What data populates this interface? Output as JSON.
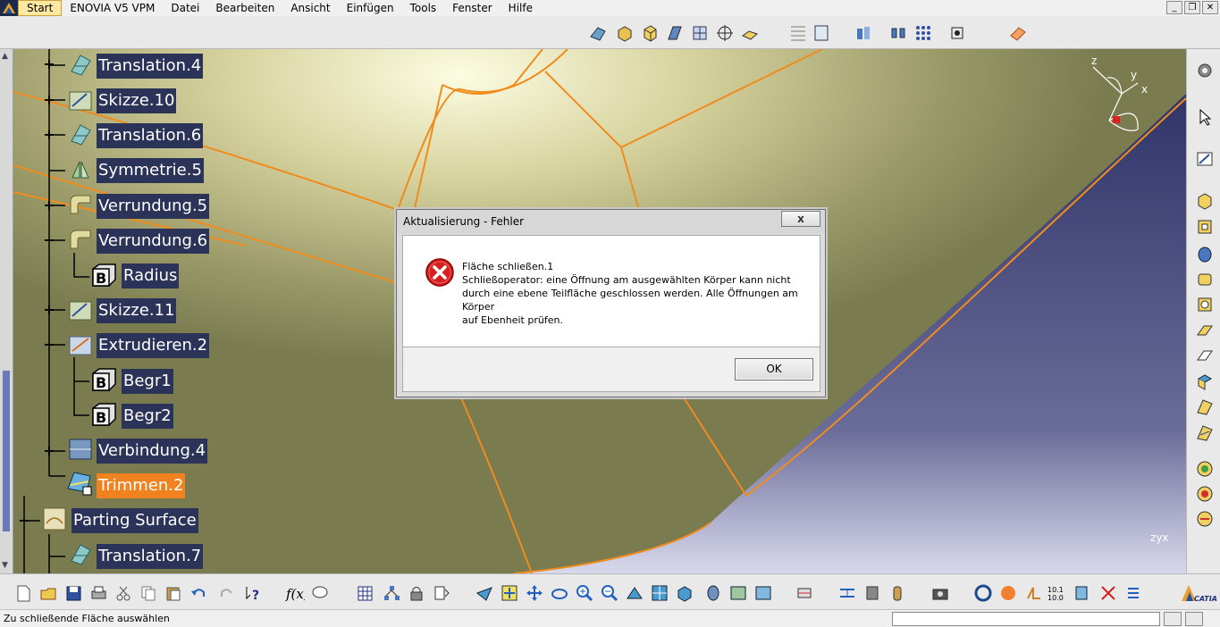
{
  "menubar": {
    "items": [
      "Start",
      "ENOVIA V5 VPM",
      "Datei",
      "Bearbeiten",
      "Ansicht",
      "Einfügen",
      "Tools",
      "Fenster",
      "Hilfe"
    ]
  },
  "tree": {
    "nodes": [
      {
        "label": "Translation.4",
        "icon": "translation-icon",
        "expander": "plus"
      },
      {
        "label": "Skizze.10",
        "icon": "sketch-icon",
        "expander": "plus"
      },
      {
        "label": "Translation.6",
        "icon": "translation-icon",
        "expander": "plus"
      },
      {
        "label": "Symmetrie.5",
        "icon": "symmetry-icon",
        "expander": "none"
      },
      {
        "label": "Verrundung.5",
        "icon": "fillet-icon",
        "expander": "plus"
      },
      {
        "label": "Verrundung.6",
        "icon": "fillet-icon",
        "expander": "minus"
      },
      {
        "label": "Radius",
        "icon": "parameter-b-icon",
        "expander": "none"
      },
      {
        "label": "Skizze.11",
        "icon": "sketch-icon",
        "expander": "plus"
      },
      {
        "label": "Extrudieren.2",
        "icon": "extrude-icon",
        "expander": "minus"
      },
      {
        "label": "Begr1",
        "icon": "parameter-b-icon",
        "expander": "none"
      },
      {
        "label": "Begr2",
        "icon": "parameter-b-icon",
        "expander": "none"
      },
      {
        "label": "Verbindung.4",
        "icon": "join-icon",
        "expander": "plus"
      },
      {
        "label": "Trimmen.2",
        "icon": "trim-icon",
        "expander": "none"
      },
      {
        "label": "Parting Surface",
        "icon": "parting-surface-icon",
        "expander": "minus"
      },
      {
        "label": "Translation.7",
        "icon": "translation-icon",
        "expander": "none"
      }
    ]
  },
  "compass": {
    "x": "x",
    "y": "y",
    "z": "z"
  },
  "dialog": {
    "title": "Aktualisierung - Fehler",
    "close_label": "x",
    "message_lines": [
      "Fläche schließen.1",
      "Schließoperator: eine Öffnung am ausgewählten Körper kann nicht",
      "durch eine ebene Teilfläche geschlossen werden. Alle Öffnungen am",
      "Körper",
      "auf Ebenheit prüfen."
    ],
    "ok_label": "OK"
  },
  "status": {
    "text": "Zu schließende Fläche auswählen",
    "input_value": ""
  },
  "colors": {
    "tree_label_bg": "#2c3358",
    "tree_highlight": "#f08220",
    "surface_edge": "#f08c1e",
    "viewport_bg_top": "#c8c8a8",
    "viewport_blue": "#4a4a7c"
  },
  "toolbar_icons": {
    "top": [
      "surface-icon",
      "box-icon",
      "cube-icon",
      "extrude-surface-icon",
      "multi-section-icon",
      "point-target-icon",
      "draft-icon",
      "grid-align-icon",
      "sheet-icon",
      "analysis-icon",
      "connect-icon",
      "pattern-icon",
      "snap-icon",
      "eraser-icon"
    ],
    "bottom": [
      "new-icon",
      "open-icon",
      "save-icon",
      "print-icon",
      "cut-icon",
      "copy-icon",
      "paste-icon",
      "undo-icon",
      "redo-icon",
      "whats-this-icon",
      "formula-icon",
      "knowledge-icon",
      "table-icon",
      "tree-graph-icon",
      "lock-icon",
      "param-icon",
      "fly-icon",
      "fit-all-icon",
      "pan-icon",
      "rotate-icon",
      "zoom-in-icon",
      "zoom-out-icon",
      "normal-view-icon",
      "multi-view-icon",
      "iso-view-icon",
      "shading-icon",
      "render-icon",
      "hide-show-icon",
      "measure-icon",
      "inertia-icon",
      "capture-icon",
      "update-icon",
      "compass-icon",
      "scale-icon",
      "tolerance-icon",
      "catia-logo"
    ],
    "right": [
      "settings-gear-icon",
      "select-arrow-icon",
      "sketch-tool-icon",
      "pad-icon",
      "pocket-icon",
      "shaft-icon",
      "groove-icon",
      "hole-icon",
      "rib-icon",
      "slot-icon",
      "stiffener-icon",
      "loft-icon",
      "remove-loft-icon",
      "draft-angle-icon",
      "shell-icon",
      "thickness-icon",
      "thread-icon"
    ]
  }
}
